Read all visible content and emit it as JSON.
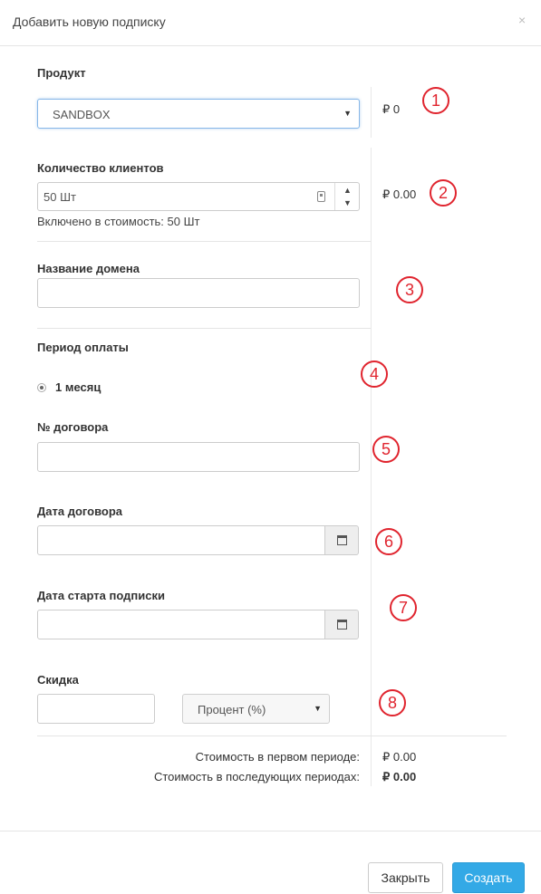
{
  "modal": {
    "title": "Добавить новую подписку",
    "close_glyph": "×"
  },
  "form": {
    "product_label": "Продукт",
    "product_value": "SANDBOX",
    "product_price": "₽ 0",
    "clients_label": "Количество клиентов",
    "clients_value": "50 Шт",
    "clients_price": "₽ 0.00",
    "clients_included": "Включено в стоимость: 50 Шт",
    "domain_label": "Название домена",
    "period_label": "Период оплаты",
    "period_option": "1 месяц",
    "contract_no_label": "№ договора",
    "contract_date_label": "Дата договора",
    "start_date_label": "Дата старта подписки",
    "discount_label": "Скидка",
    "discount_type": "Процент (%)"
  },
  "summary": {
    "first_period_label": "Стоимость в первом периоде:",
    "first_period_value": "₽ 0.00",
    "next_periods_label": "Стоимость в последующих периодах:",
    "next_periods_value": "₽ 0.00"
  },
  "annotations": [
    "1",
    "2",
    "3",
    "4",
    "5",
    "6",
    "7",
    "8"
  ],
  "footer": {
    "close_button": "Закрыть",
    "create_button": "Создать"
  },
  "colors": {
    "primary": "#33a9e6",
    "annotation": "#e0242e"
  }
}
